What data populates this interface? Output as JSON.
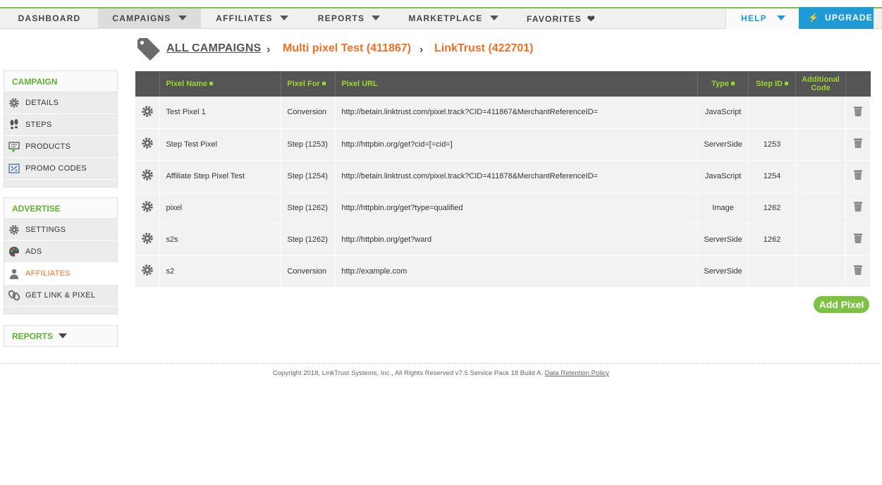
{
  "nav": {
    "dashboard": "DASHBOARD",
    "campaigns": "CAMPAIGNS",
    "affiliates": "AFFILIATES",
    "reports": "REPORTS",
    "marketplace": "MARKETPLACE",
    "favorites": "FAVORITES",
    "help": "HELP",
    "upgrade": "UPGRADE"
  },
  "breadcrumb": {
    "root": "ALL CAMPAIGNS",
    "campaign": "Multi pixel Test (411867)",
    "affiliate": "LinkTrust (422701)"
  },
  "sidebar": {
    "campaign_head": "CAMPAIGN",
    "campaign_items": [
      {
        "label": "DETAILS",
        "icon": "gear-icon"
      },
      {
        "label": "STEPS",
        "icon": "footsteps-icon"
      },
      {
        "label": "PRODUCTS",
        "icon": "products-icon"
      },
      {
        "label": "PROMO CODES",
        "icon": "promo-code-icon"
      }
    ],
    "advertise_head": "ADVERTISE",
    "advertise_items": [
      {
        "label": "SETTINGS",
        "icon": "gear-icon"
      },
      {
        "label": "ADS",
        "icon": "palette-icon"
      },
      {
        "label": "AFFILIATES",
        "icon": "person-icon"
      },
      {
        "label": "GET LINK & PIXEL",
        "icon": "link-icon"
      }
    ],
    "reports_head": "REPORTS"
  },
  "table": {
    "headers": {
      "pixel_name": "Pixel Name",
      "pixel_for": "Pixel For",
      "pixel_url": "Pixel URL",
      "type": "Type",
      "step_id": "Step ID",
      "additional_code": "Additional Code"
    },
    "rows": [
      {
        "name": "Test Pixel 1",
        "for": "Conversion",
        "url": "http://betain.linktrust.com/pixel.track?CID=411867&MerchantReferenceID=",
        "type": "JavaScript",
        "step_id": "",
        "code": ""
      },
      {
        "name": "Step Test Pixel",
        "for": "Step (1253)",
        "url": "http://httpbin.org/get?cid=[=cid=]",
        "type": "ServerSide",
        "step_id": "1253",
        "code": ""
      },
      {
        "name": "Affiliate Step Pixel Test",
        "for": "Step (1254)",
        "url": "http://betain.linktrust.com/pixel.track?CID=411878&MerchantReferenceID=",
        "type": "JavaScript",
        "step_id": "1254",
        "code": ""
      },
      {
        "name": "pixel",
        "for": "Step (1262)",
        "url": "http://httpbin.org/get?type=qualified",
        "type": "Image",
        "step_id": "1262",
        "code": ""
      },
      {
        "name": "s2s",
        "for": "Step (1262)",
        "url": "http://httpbin.org/get?ward",
        "type": "ServerSide",
        "step_id": "1262",
        "code": ""
      },
      {
        "name": "s2",
        "for": "Conversion",
        "url": "http://example.com",
        "type": "ServerSide",
        "step_id": "",
        "code": ""
      }
    ]
  },
  "add_pixel": "Add Pixel",
  "footer": {
    "copyright": "Copyright 2018, LinkTrust Systems, Inc., All Rights Reserved v7.5 Service Pack 18 Build A.",
    "policy_link": "Data Retention Policy"
  },
  "colors": {
    "accent_green": "#7dc242",
    "accent_orange": "#f26f21",
    "accent_blue": "#1e9bd7",
    "header_dark": "#555555"
  }
}
